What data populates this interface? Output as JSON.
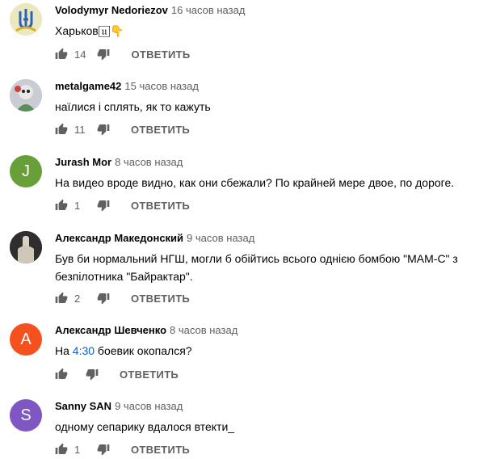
{
  "comments": [
    {
      "author": "Volodymyr Nedoriezov",
      "time": "16 часов назад",
      "text_lines": [
        "Харьков 𝔲⃞ 👇"
      ],
      "likes": "14",
      "reply_label": "ОТВЕТИТЬ",
      "avatar": {
        "type": "trident",
        "bg": "#e8e4b8"
      }
    },
    {
      "author": "metalgame42",
      "time": "15 часов назад",
      "text_lines": [
        "наїлися і сплять, як то кажуть"
      ],
      "likes": "11",
      "reply_label": "ОТВЕТИТЬ",
      "avatar": {
        "type": "image",
        "bg": "#9aa0a8"
      }
    },
    {
      "author": "Jurash Mor",
      "time": "8 часов назад",
      "text_lines": [
        "На видео вроде видно, как они сбежали? По крайней мере двое, по дороге."
      ],
      "likes": "1",
      "reply_label": "ОТВЕТИТЬ",
      "avatar": {
        "type": "letter",
        "letter": "J",
        "bg": "#689f38"
      }
    },
    {
      "author": "Александр Македонский",
      "time": "9 часов назад",
      "text_lines": [
        "Був би нормальний НГШ, могли б обійтись всього однією бомбою \"МАМ-С\" з",
        "безпілотника \"Байрактар\"."
      ],
      "likes": "2",
      "reply_label": "ОТВЕТИТЬ",
      "avatar": {
        "type": "image",
        "bg": "#3a3a3a"
      }
    },
    {
      "author": "Александр Шевченко",
      "time": "8 часов назад",
      "text_prefix": "На ",
      "text_link": "4:30",
      "text_suffix": " боевик окопался?",
      "likes": "",
      "reply_label": "ОТВЕТИТЬ",
      "avatar": {
        "type": "letter",
        "letter": "A",
        "bg": "#f4511e"
      }
    },
    {
      "author": "Sanny SAN",
      "time": "9 часов назад",
      "text_lines": [
        "одному сепарику вдалося втекти_"
      ],
      "likes": "1",
      "reply_label": "ОТВЕТИТЬ",
      "avatar": {
        "type": "letter",
        "letter": "S",
        "bg": "#7e57c2"
      }
    }
  ]
}
